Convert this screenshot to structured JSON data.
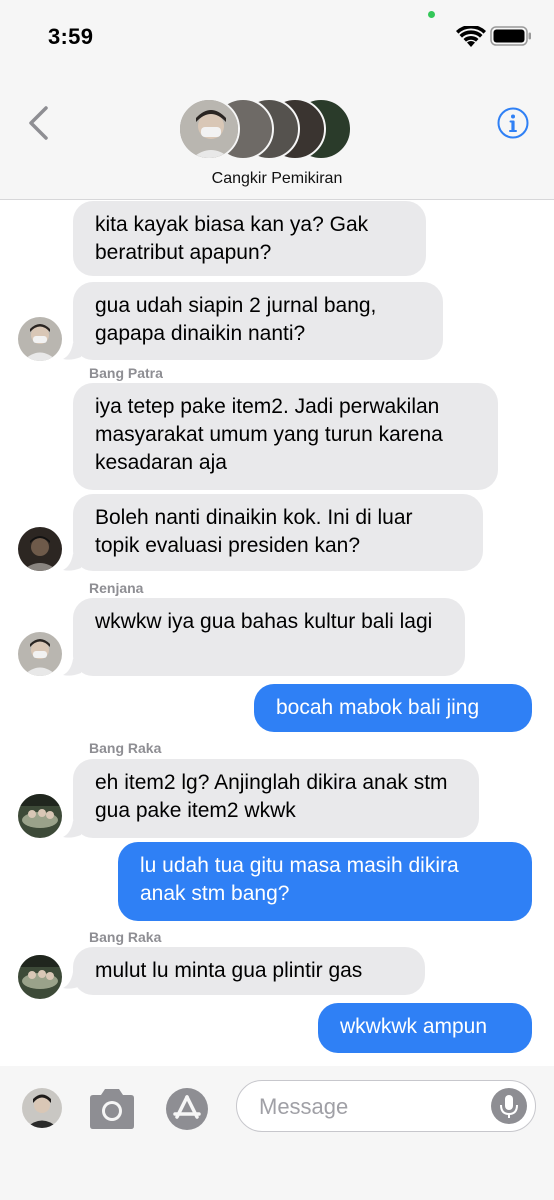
{
  "status_bar": {
    "time": "3:59"
  },
  "header": {
    "group_name": "Cangkir Pemikiran"
  },
  "messages": [
    {
      "text": "kita kayak biasa kan ya? Gak beratribut apapun?"
    },
    {
      "text": "gua udah siapin 2 jurnal bang, gapapa dinaikin nanti?"
    },
    {
      "sender": "Bang Patra",
      "text": "iya tetep pake item2. Jadi perwakilan masyarakat umum yang turun karena kesadaran aja"
    },
    {
      "text": "Boleh nanti dinaikin kok. Ini di luar topik evaluasi presiden kan?"
    },
    {
      "sender": "Renjana",
      "text": "wkwkw iya gua bahas kultur bali lagi"
    },
    {
      "text": "bocah mabok bali jing"
    },
    {
      "sender": "Bang Raka",
      "text": "eh item2 lg? Anjinglah dikira anak stm gua pake item2 wkwk"
    },
    {
      "text": "lu udah tua gitu masa masih dikira anak stm bang?"
    },
    {
      "sender": "Bang Raka",
      "text": "mulut lu minta gua plintir gas"
    },
    {
      "text": "wkwkwk ampun"
    }
  ],
  "input": {
    "placeholder": "Message"
  },
  "colors": {
    "outgoing": "#2f80f5",
    "incoming": "#e9e9eb",
    "accent": "#2f80f5"
  },
  "icons": [
    "back-chevron-icon",
    "info-icon",
    "camera-icon",
    "app-store-icon",
    "mic-icon",
    "wifi-icon",
    "battery-icon"
  ]
}
